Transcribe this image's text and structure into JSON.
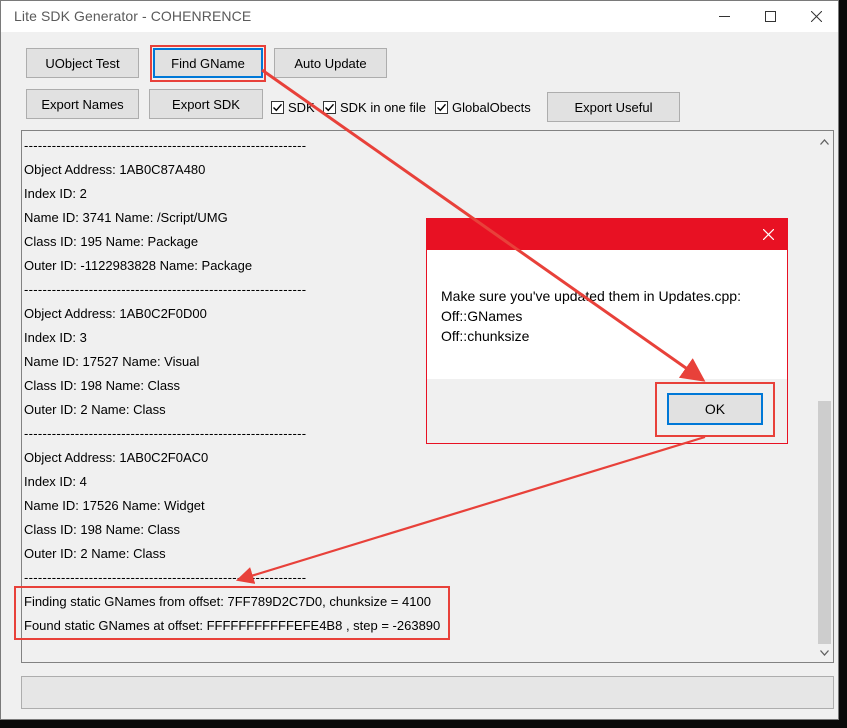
{
  "window": {
    "title": "Lite SDK Generator - COHENRENCE"
  },
  "toolbar": {
    "uobject_test": "UObject Test",
    "find_gname": "Find GName",
    "auto_update": "Auto Update",
    "export_names": "Export Names",
    "export_sdk": "Export SDK",
    "export_useful": "Export Useful",
    "chk_sdk": {
      "label": "SDK",
      "checked": true
    },
    "chk_sdk_one_file": {
      "label": "SDK in one file",
      "checked": true
    },
    "chk_global_objects": {
      "label": "GlobalObects",
      "checked": true
    }
  },
  "console": {
    "lines": [
      "-------------------------------------------------------------",
      "Object Address: 1AB0C87A480",
      "Index ID: 2",
      "Name ID: 3741 Name: /Script/UMG",
      "Class ID: 195 Name: Package",
      "Outer ID: -1122983828 Name: Package",
      "-------------------------------------------------------------",
      "Object Address: 1AB0C2F0D00",
      "Index ID: 3",
      "Name ID: 17527 Name: Visual",
      "Class ID: 198 Name: Class",
      "Outer ID: 2 Name: Class",
      "-------------------------------------------------------------",
      "Object Address: 1AB0C2F0AC0",
      "Index ID: 4",
      "Name ID: 17526 Name: Widget",
      "Class ID: 198 Name: Class",
      "Outer ID: 2 Name: Class",
      "-------------------------------------------------------------",
      "Finding static GNames from offset: 7FF789D2C7D0, chunksize = 4100",
      "Found static GNames at offset: FFFFFFFFFFFEFE4B8 , step = -263890"
    ]
  },
  "dialog": {
    "message_lines": [
      "Make sure you've updated them in Updates.cpp:",
      "Off::GNames",
      "Off::chunksize"
    ],
    "ok_label": "OK"
  },
  "colors": {
    "dialog_accent": "#e81123",
    "annotation": "#e8413a",
    "focus_border": "#0078d7"
  },
  "icons": {
    "minimize": "minimize-icon",
    "maximize": "maximize-icon",
    "close": "close-icon",
    "checkbox": "checkmark-icon"
  }
}
